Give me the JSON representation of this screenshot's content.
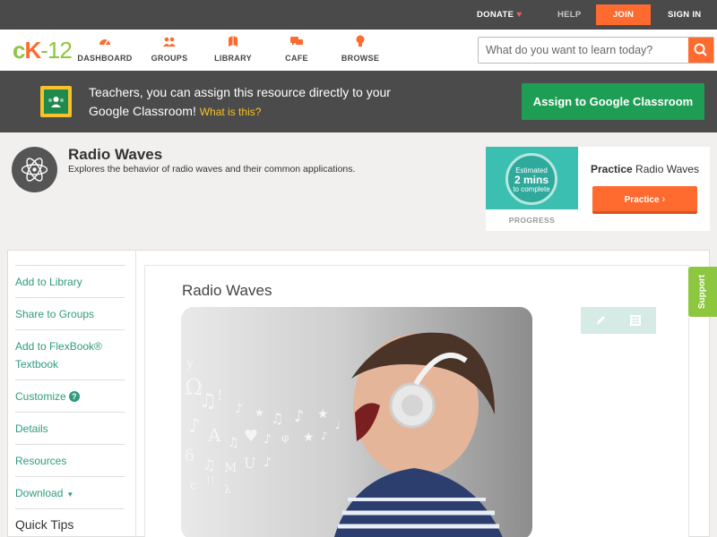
{
  "topbar": {
    "donate": "DONATE",
    "help": "HELP",
    "join": "JOIN",
    "signin": "SIGN IN"
  },
  "logo": {
    "c": "c",
    "k": "K",
    "n": "-12"
  },
  "nav": {
    "items": [
      {
        "label": "DASHBOARD",
        "icon": "dashboard-icon"
      },
      {
        "label": "GROUPS",
        "icon": "groups-icon"
      },
      {
        "label": "LIBRARY",
        "icon": "library-icon"
      },
      {
        "label": "CAFE",
        "icon": "cafe-icon"
      },
      {
        "label": "BROWSE",
        "icon": "browse-icon"
      }
    ],
    "search_placeholder": "What do you want to learn today?"
  },
  "classroom": {
    "text": "Teachers, you can assign this resource directly to your Google Classroom!",
    "link": "What is this?",
    "button": "Assign to Google Classroom"
  },
  "resource": {
    "title": "Radio Waves",
    "description": "Explores the behavior of radio waves and their common applications."
  },
  "practice": {
    "estimated_line1": "Estimated",
    "estimated_line2": "2 mins",
    "estimated_line3": "to complete",
    "progress_label": "PROGRESS",
    "title_bold": "Practice",
    "title_rest": "Radio Waves",
    "button": "Practice"
  },
  "sidebar": {
    "items": [
      "Add to Library",
      "Share to Groups",
      "Add to FlexBook® Textbook",
      "Customize",
      "Details",
      "Resources",
      "Download"
    ],
    "quick_tips": "Quick Tips"
  },
  "content": {
    "title": "Radio Waves"
  },
  "support": "Support",
  "colors": {
    "orange": "#ff6a2e",
    "green": "#8dc63f",
    "teal": "#2f9c7f",
    "dark": "#4a4a4a"
  }
}
